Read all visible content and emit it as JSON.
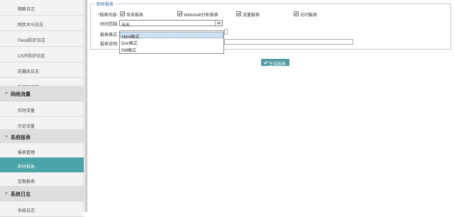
{
  "sidebar": {
    "items_top": [
      {
        "label": "隔断日志"
      },
      {
        "label": "网页木马日志"
      },
      {
        "label": "Flood防护日志"
      },
      {
        "label": "CS环防护日志"
      },
      {
        "label": "防篡改日志"
      },
      {
        "label": "新密码日志"
      }
    ],
    "group_traffic": {
      "label": "网络流量",
      "items": [
        {
          "label": "实时流量"
        },
        {
          "label": "历史流量"
        }
      ]
    },
    "group_reports": {
      "label": "系统报表",
      "items": [
        {
          "label": "报表管理"
        },
        {
          "label": "即时报表"
        },
        {
          "label": "定期报表"
        }
      ]
    },
    "group_logs": {
      "label": "系统日志",
      "items": [
        {
          "label": "系统日志"
        }
      ]
    }
  },
  "panel": {
    "title": "即时报表",
    "content_label": "*报表内容:",
    "checkboxes": [
      {
        "label": "攻击报表",
        "checked": true
      },
      {
        "label": "Webshell分析报表",
        "checked": true
      },
      {
        "label": "流量报表",
        "checked": true
      },
      {
        "label": "访问报表",
        "checked": true
      }
    ],
    "time_range_label": "时间范围:",
    "time_range_value": "当天",
    "format_label": "报表格式:",
    "format_options": [
      "Html格式",
      "Doc格式",
      "Pdf格式"
    ],
    "name_label": "报表名称:",
    "desc_label": "报表说明:",
    "generate_button": "生成报表"
  },
  "colors": {
    "accent": "#4aa5a9",
    "button": "#4f9ba0",
    "panel_title": "#2e6da4"
  }
}
